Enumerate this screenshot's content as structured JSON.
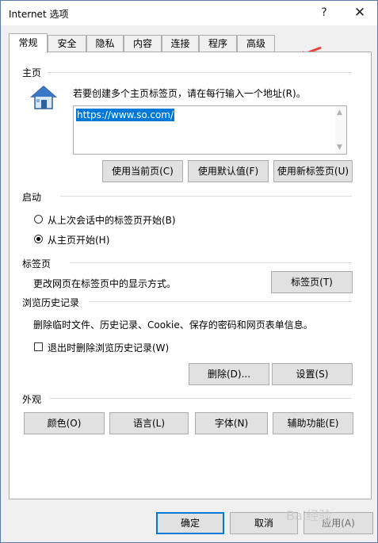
{
  "window": {
    "title": "Internet 选项",
    "help_label": "?",
    "close_label": "✕"
  },
  "tabs": [
    {
      "label": "常规"
    },
    {
      "label": "安全"
    },
    {
      "label": "隐私"
    },
    {
      "label": "内容"
    },
    {
      "label": "连接"
    },
    {
      "label": "程序"
    },
    {
      "label": "高级"
    }
  ],
  "home": {
    "section_title": "主页",
    "description": "若要创建多个主页标签页，请在每行输入一个地址(R)。",
    "url": "https://www.so.com/",
    "buttons": {
      "use_current": "使用当前页(C)",
      "use_default": "使用默认值(F)",
      "use_new_tab": "使用新标签页(U)"
    }
  },
  "startup": {
    "section_title": "启动",
    "options": [
      {
        "label": "从上次会话中的标签页开始(B)",
        "selected": false
      },
      {
        "label": "从主页开始(H)",
        "selected": true
      }
    ]
  },
  "tabs_section": {
    "section_title": "标签页",
    "description": "更改网页在标签页中的显示方式。",
    "button": "标签页(T)"
  },
  "history": {
    "section_title": "浏览历史记录",
    "description": "删除临时文件、历史记录、Cookie、保存的密码和网页表单信息。",
    "checkbox_label": "退出时删除浏览历史记录(W)",
    "checkbox_checked": false,
    "buttons": {
      "delete": "删除(D)...",
      "settings": "设置(S)"
    }
  },
  "appearance": {
    "section_title": "外观",
    "buttons": {
      "colors": "颜色(O)",
      "languages": "语言(L)",
      "fonts": "字体(N)",
      "accessibility": "辅助功能(E)"
    }
  },
  "footer": {
    "ok": "确定",
    "cancel": "取消",
    "apply": "应用(A)"
  },
  "overlay": {
    "watermark": "Bai经验"
  },
  "colors": {
    "accent": "#0078d7",
    "annotation_arrow": "#e8433a"
  },
  "icons": {
    "home": "house-icon",
    "annotation": "red-arrow-icon"
  }
}
